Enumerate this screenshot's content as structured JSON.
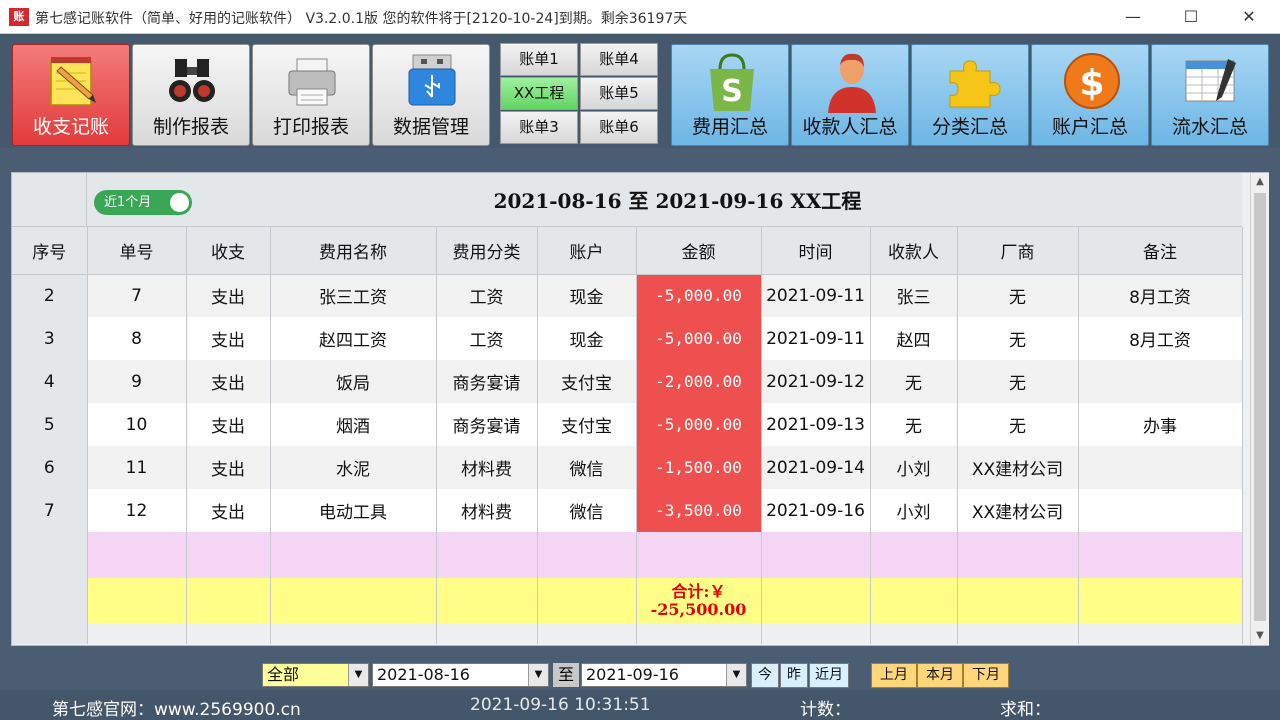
{
  "window": {
    "title": "第七感记账软件（简单、好用的记账软件） V3.2.0.1版 您的软件将于[2120-10-24]到期。剩余36197天",
    "icon_text": "账",
    "min": "—",
    "max": "☐",
    "close": "✕"
  },
  "toolbar": {
    "main_buttons": [
      {
        "label": "收支记账",
        "icon": "notepad-pencil-icon",
        "active": true
      },
      {
        "label": "制作报表",
        "icon": "binoculars-icon",
        "active": false
      },
      {
        "label": "打印报表",
        "icon": "printer-icon",
        "active": false
      },
      {
        "label": "数据管理",
        "icon": "usb-drive-icon",
        "active": false
      }
    ],
    "ledgers": [
      "账单1",
      "账单4",
      "XX工程",
      "账单5",
      "账单3",
      "账单6"
    ],
    "selected_ledger": "XX工程",
    "summary_buttons": [
      {
        "label": "费用汇总",
        "icon": "shopping-bag-icon"
      },
      {
        "label": "收款人汇总",
        "icon": "person-icon"
      },
      {
        "label": "分类汇总",
        "icon": "puzzle-icon"
      },
      {
        "label": "账户汇总",
        "icon": "dollar-coin-icon"
      },
      {
        "label": "流水汇总",
        "icon": "spreadsheet-pen-icon"
      }
    ]
  },
  "grid": {
    "toggle_label": "近1个月",
    "period_title": "2021-08-16  至  2021-09-16  XX工程",
    "columns": [
      "序号",
      "单号",
      "收支",
      "费用名称",
      "费用分类",
      "账户",
      "金额",
      "时间",
      "收款人",
      "厂商",
      "备注"
    ],
    "rows": [
      [
        "2",
        "7",
        "支出",
        "张三工资",
        "工资",
        "现金",
        "-5,000.00",
        "2021-09-11",
        "张三",
        "无",
        "8月工资"
      ],
      [
        "3",
        "8",
        "支出",
        "赵四工资",
        "工资",
        "现金",
        "-5,000.00",
        "2021-09-11",
        "赵四",
        "无",
        "8月工资"
      ],
      [
        "4",
        "9",
        "支出",
        "饭局",
        "商务宴请",
        "支付宝",
        "-2,000.00",
        "2021-09-12",
        "无",
        "无",
        ""
      ],
      [
        "5",
        "10",
        "支出",
        "烟酒",
        "商务宴请",
        "支付宝",
        "-5,000.00",
        "2021-09-13",
        "无",
        "无",
        "办事"
      ],
      [
        "6",
        "11",
        "支出",
        "水泥",
        "材料费",
        "微信",
        "-1,500.00",
        "2021-09-14",
        "小刘",
        "XX建材公司",
        ""
      ],
      [
        "7",
        "12",
        "支出",
        "电动工具",
        "材料费",
        "微信",
        "-3,500.00",
        "2021-09-16",
        "小刘",
        "XX建材公司",
        ""
      ]
    ],
    "total_label": "合计:￥",
    "total_value": "-25,500.00"
  },
  "filter": {
    "type_value": "全部",
    "start_date": "2021-08-16",
    "to_label": "至",
    "end_date": "2021-09-16",
    "quick": [
      "今",
      "昨",
      "近月"
    ],
    "months": [
      "上月",
      "本月",
      "下月"
    ]
  },
  "status": {
    "site": "第七感官网：www.2569900.cn",
    "time": "2021-09-16 10:31:51",
    "count_label": "计数：",
    "sum_label": "求和："
  },
  "colors": {
    "accent_red": "#e23b3b",
    "amount_cell": "#ee4f4f",
    "selected_ledger": "#62d462",
    "summary_blue": "#6db6e5",
    "total_row": "#ffff88",
    "new_row": "#f5d6f5"
  }
}
